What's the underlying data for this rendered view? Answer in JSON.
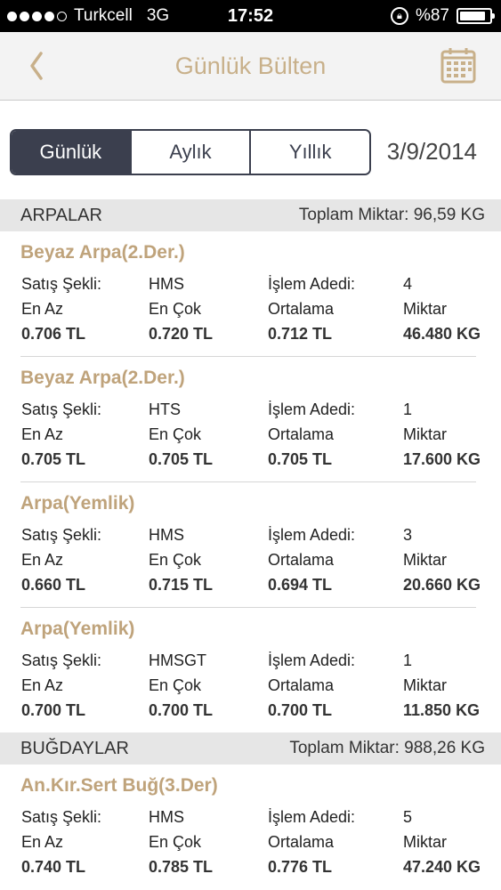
{
  "status_bar": {
    "carrier": "Turkcell",
    "network": "3G",
    "time": "17:52",
    "battery": "%87",
    "battery_level": 0.87
  },
  "nav": {
    "title": "Günlük Bülten",
    "back_icon": "chevron-left-icon",
    "calendar_icon": "calendar-icon",
    "accent_color": "#c8b08a"
  },
  "segments": {
    "items": [
      "Günlük",
      "Aylık",
      "Yıllık"
    ],
    "selected": "Günlük",
    "date": "3/9/2014"
  },
  "sections": [
    {
      "title": "ARPALAR",
      "total": "Toplam Miktar: 96,59 KG",
      "items": [
        {
          "name": "Beyaz Arpa(2.Der.)",
          "sale_label": "Satış Şekli:",
          "sale": "HMS",
          "count_label": "İşlem Adedi:",
          "count": "4",
          "min_label": "En Az",
          "max_label": "En Çok",
          "avg_label": "Ortalama",
          "qty_label": "Miktar",
          "min": "0.706 TL",
          "max": "0.720 TL",
          "avg": "0.712 TL",
          "qty": "46.480 KG"
        },
        {
          "name": "Beyaz Arpa(2.Der.)",
          "sale_label": "Satış Şekli:",
          "sale": "HTS",
          "count_label": "İşlem Adedi:",
          "count": "1",
          "min_label": "En Az",
          "max_label": "En Çok",
          "avg_label": "Ortalama",
          "qty_label": "Miktar",
          "min": "0.705 TL",
          "max": "0.705 TL",
          "avg": "0.705 TL",
          "qty": "17.600 KG"
        },
        {
          "name": "Arpa(Yemlik)",
          "sale_label": "Satış Şekli:",
          "sale": "HMS",
          "count_label": "İşlem Adedi:",
          "count": "3",
          "min_label": "En Az",
          "max_label": "En Çok",
          "avg_label": "Ortalama",
          "qty_label": "Miktar",
          "min": "0.660 TL",
          "max": "0.715 TL",
          "avg": "0.694 TL",
          "qty": "20.660 KG"
        },
        {
          "name": "Arpa(Yemlik)",
          "sale_label": "Satış Şekli:",
          "sale": "HMSGT",
          "count_label": "İşlem Adedi:",
          "count": "1",
          "min_label": "En Az",
          "max_label": "En Çok",
          "avg_label": "Ortalama",
          "qty_label": "Miktar",
          "min": "0.700 TL",
          "max": "0.700 TL",
          "avg": "0.700 TL",
          "qty": "11.850 KG"
        }
      ]
    },
    {
      "title": "BUĞDAYLAR",
      "total": "Toplam Miktar: 988,26 KG",
      "items": [
        {
          "name": "An.Kır.Sert Buğ(3.Der)",
          "sale_label": "Satış Şekli:",
          "sale": "HMS",
          "count_label": "İşlem Adedi:",
          "count": "5",
          "min_label": "En Az",
          "max_label": "En Çok",
          "avg_label": "Ortalama",
          "qty_label": "Miktar",
          "min": "0.740 TL",
          "max": "0.785 TL",
          "avg": "0.776 TL",
          "qty": "47.240 KG"
        }
      ]
    }
  ]
}
